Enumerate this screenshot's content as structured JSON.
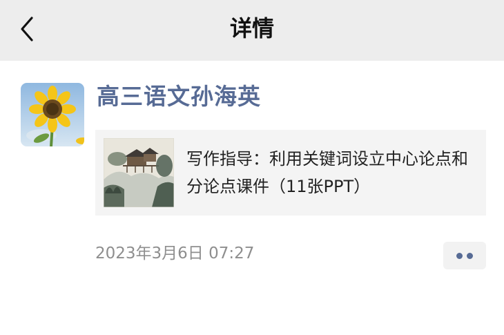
{
  "nav": {
    "title": "详情",
    "back_icon": "chevron-left-icon"
  },
  "post": {
    "author": "高三语文孙海英",
    "avatar": "sunflower",
    "share": {
      "title": "写作指导：利用关键词设立中心论点和分论点课件（11张PPT）",
      "thumbnail": "ink-wash-landscape"
    },
    "time": "2023年3月6日 07:27",
    "more_icon": "more-dots-icon"
  },
  "colors": {
    "nav_background": "#ededed",
    "link_blue": "#576b95",
    "card_background": "#f4f4f4",
    "timestamp_gray": "#8e8e8e"
  }
}
